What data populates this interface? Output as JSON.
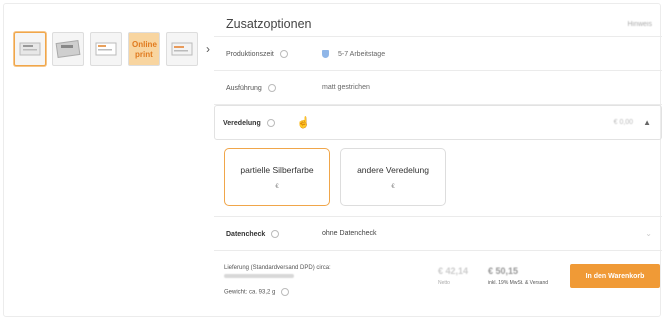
{
  "thumbnails": [
    {
      "icon": "product-image",
      "active": true
    },
    {
      "icon": "product-image",
      "active": false
    },
    {
      "icon": "product-image",
      "active": false
    },
    {
      "icon": "online-print-logo",
      "text": "Online print",
      "active": false
    },
    {
      "icon": "product-image",
      "active": false
    }
  ],
  "section": {
    "title": "Zusatzoptionen",
    "hint": "Hinweis"
  },
  "rows": {
    "produktionszeit": {
      "label": "Produktionszeit",
      "value": "5-7 Arbeitstage"
    },
    "ausfuehrung": {
      "label": "Ausführung",
      "value": "matt gestrichen"
    }
  },
  "veredelung": {
    "label": "Veredelung",
    "price": "€ 0,00",
    "options": [
      {
        "name": "partielle Silberfarbe",
        "price": "€",
        "selected": true
      },
      {
        "name": "andere Veredelung",
        "price": "€",
        "selected": false
      }
    ]
  },
  "datencheck": {
    "label": "Datencheck",
    "value": "ohne Datencheck"
  },
  "footer": {
    "delivery": "Lieferung (Standardversand DPD) circa:",
    "weight": "Gewicht: ca. 93,2 g",
    "old_price": "€ 42,14",
    "new_price": "€ 50,15",
    "netto": "Netto",
    "vat": "inkl. 19% MwSt. & Versand",
    "cart_button": "In den Warenkorb"
  },
  "colors": {
    "accent": "#f09a36",
    "selected_border": "#f0a64a"
  }
}
